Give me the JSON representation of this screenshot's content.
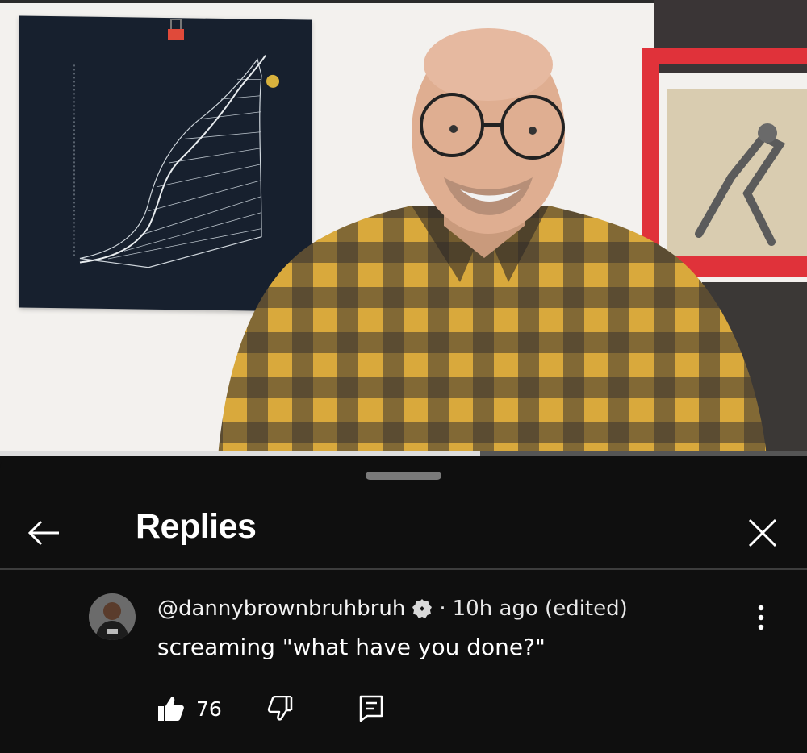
{
  "video": {
    "progress_fraction": 0.595
  },
  "sheet": {
    "title": "Replies"
  },
  "comment": {
    "author": "@dannybrownbruhbruh",
    "separator": "·",
    "time": "10h ago (edited)",
    "text": "screaming \"what have you done?\"",
    "like_count": "76"
  },
  "icons": {
    "back": "arrow-left-icon",
    "close": "close-icon",
    "more": "more-vertical-icon",
    "verified": "verified-badge-icon",
    "like": "thumbs-up-icon",
    "dislike": "thumbs-down-icon",
    "reply": "reply-icon"
  },
  "colors": {
    "sheet_background": "#0f0f0f",
    "text": "#ffffff",
    "divider": "#3d3d3d",
    "shelf_red": "#e0323a",
    "shirt_yellow": "#d9a93c"
  }
}
